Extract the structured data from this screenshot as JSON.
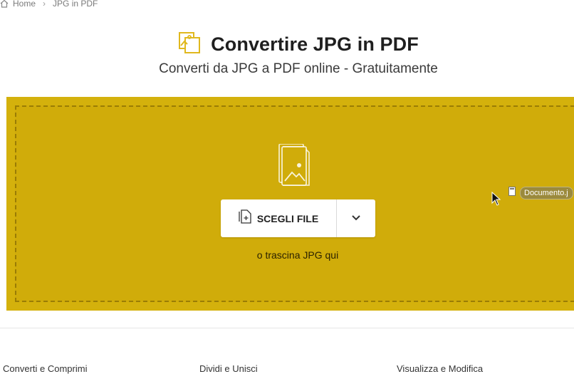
{
  "breadcrumb": {
    "home": "Home",
    "separator": "›",
    "current": "JPG in PDF"
  },
  "header": {
    "title": "Convertire JPG in PDF",
    "subtitle": "Converti da JPG a PDF online - Gratuitamente"
  },
  "dropzone": {
    "background_color": "#d4b10c",
    "choose_button_label": "SCEGLI FILE",
    "drag_hint": "o trascina JPG qui",
    "dragged_file_name": "Documento.j"
  },
  "footer": {
    "columns": [
      "Converti e Comprimi",
      "Dividi e Unisci",
      "Visualizza e Modifica"
    ]
  },
  "icons": {
    "title": "image-file-icon",
    "dropzone": "files-stack-icon",
    "choose": "add-file-icon",
    "dropdown": "chevron-down-icon",
    "cursor": "mouse-pointer-icon"
  },
  "colors": {
    "accent": "#d4b10c",
    "title_icon": "#e0b81e"
  }
}
